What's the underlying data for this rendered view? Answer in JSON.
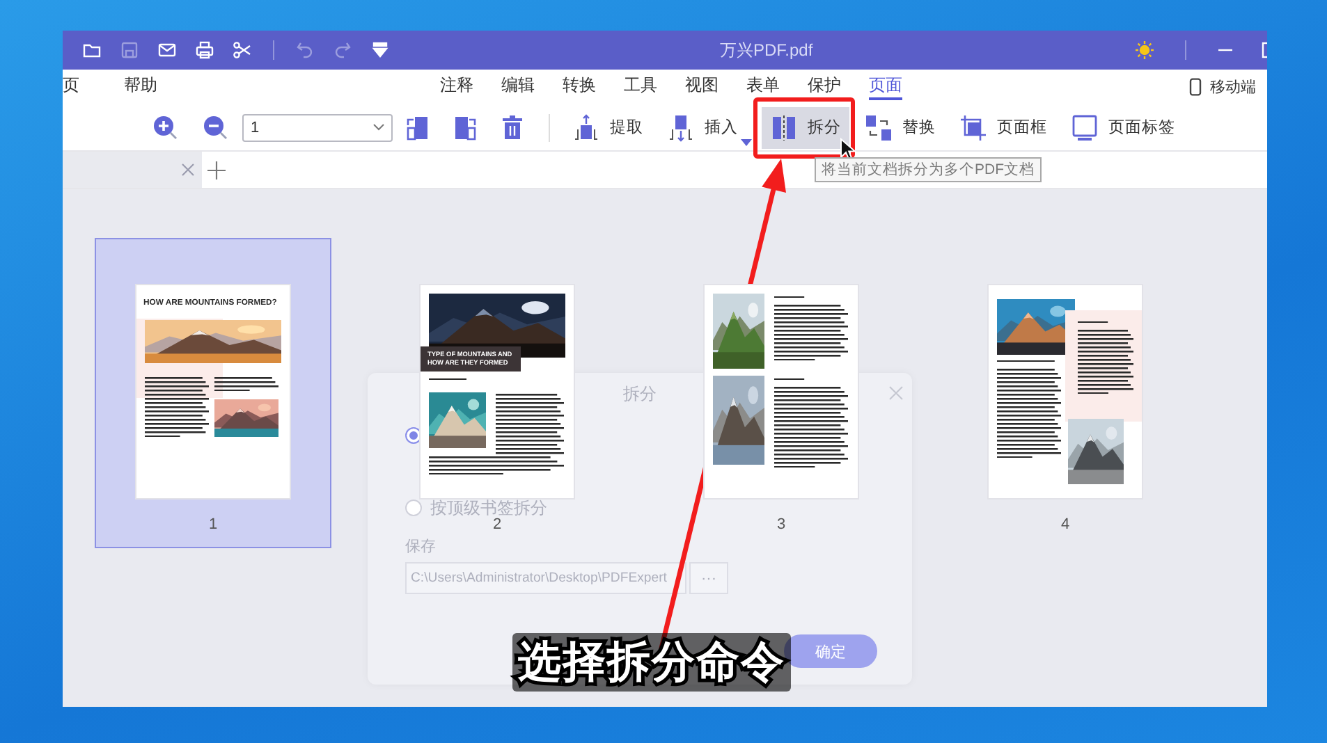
{
  "window": {
    "title": "万兴PDF.pdf"
  },
  "quick_toolbar": [
    {
      "kind": "folder",
      "disabled": false
    },
    {
      "kind": "save",
      "disabled": true
    },
    {
      "kind": "mail",
      "disabled": false
    },
    {
      "kind": "print",
      "disabled": false
    },
    {
      "kind": "scissors",
      "disabled": false
    },
    {
      "kind": "undo",
      "disabled": true
    },
    {
      "kind": "redo",
      "disabled": true
    },
    {
      "kind": "dropdown",
      "disabled": false
    }
  ],
  "menu": {
    "left": [
      {
        "label": "页",
        "selected": false
      },
      {
        "label": "帮助",
        "selected": false
      }
    ],
    "main": [
      {
        "label": "注释",
        "selected": false
      },
      {
        "label": "编辑",
        "selected": false
      },
      {
        "label": "转换",
        "selected": false
      },
      {
        "label": "工具",
        "selected": false
      },
      {
        "label": "视图",
        "selected": false
      },
      {
        "label": "表单",
        "selected": false
      },
      {
        "label": "保护",
        "selected": false
      },
      {
        "label": "页面",
        "selected": true
      }
    ],
    "mobile": "移动端"
  },
  "toolbar": {
    "view_tools": [
      {
        "kind": "zoom_in"
      },
      {
        "kind": "zoom_out"
      }
    ],
    "page_select": {
      "value": "1"
    },
    "page_tools": [
      {
        "kind": "rotate_left"
      },
      {
        "kind": "rotate_right"
      },
      {
        "kind": "delete"
      }
    ],
    "tools": [
      {
        "kind": "extract",
        "label": "提取",
        "hovered": false,
        "has_menu": false
      },
      {
        "kind": "insert",
        "label": "插入",
        "hovered": false,
        "has_menu": true
      },
      {
        "kind": "split",
        "label": "拆分",
        "hovered": true,
        "has_menu": false
      },
      {
        "kind": "replace",
        "label": "替换",
        "hovered": false,
        "has_menu": false
      },
      {
        "kind": "page_box",
        "label": "页面框",
        "hovered": false,
        "has_menu": false
      },
      {
        "kind": "page_label",
        "label": "页面标签",
        "hovered": false,
        "has_menu": false
      }
    ]
  },
  "tooltip": "将当前文档拆分为多个PDF文档",
  "pages": [
    {
      "number": "1",
      "selected": true,
      "kind": "title",
      "title": "HOW ARE MOUNTAINS FORMED?"
    },
    {
      "number": "2",
      "selected": false,
      "kind": "cover",
      "title": "TYPE OF MOUNTAINS AND HOW ARE THEY FORMED"
    },
    {
      "number": "3",
      "selected": false,
      "kind": "two_photos"
    },
    {
      "number": "4",
      "selected": false,
      "kind": "mixed"
    }
  ],
  "dialog": {
    "title": "拆分",
    "options": [
      {
        "selected": true
      },
      {
        "label": "按顶级书签拆分",
        "selected": false
      }
    ],
    "save_label": "保存",
    "path": "C:\\Users\\Administrator\\Desktop\\PDFExpert",
    "browse": "···",
    "confirm": "确定"
  },
  "annotation": {
    "caption": "选择拆分命令"
  }
}
